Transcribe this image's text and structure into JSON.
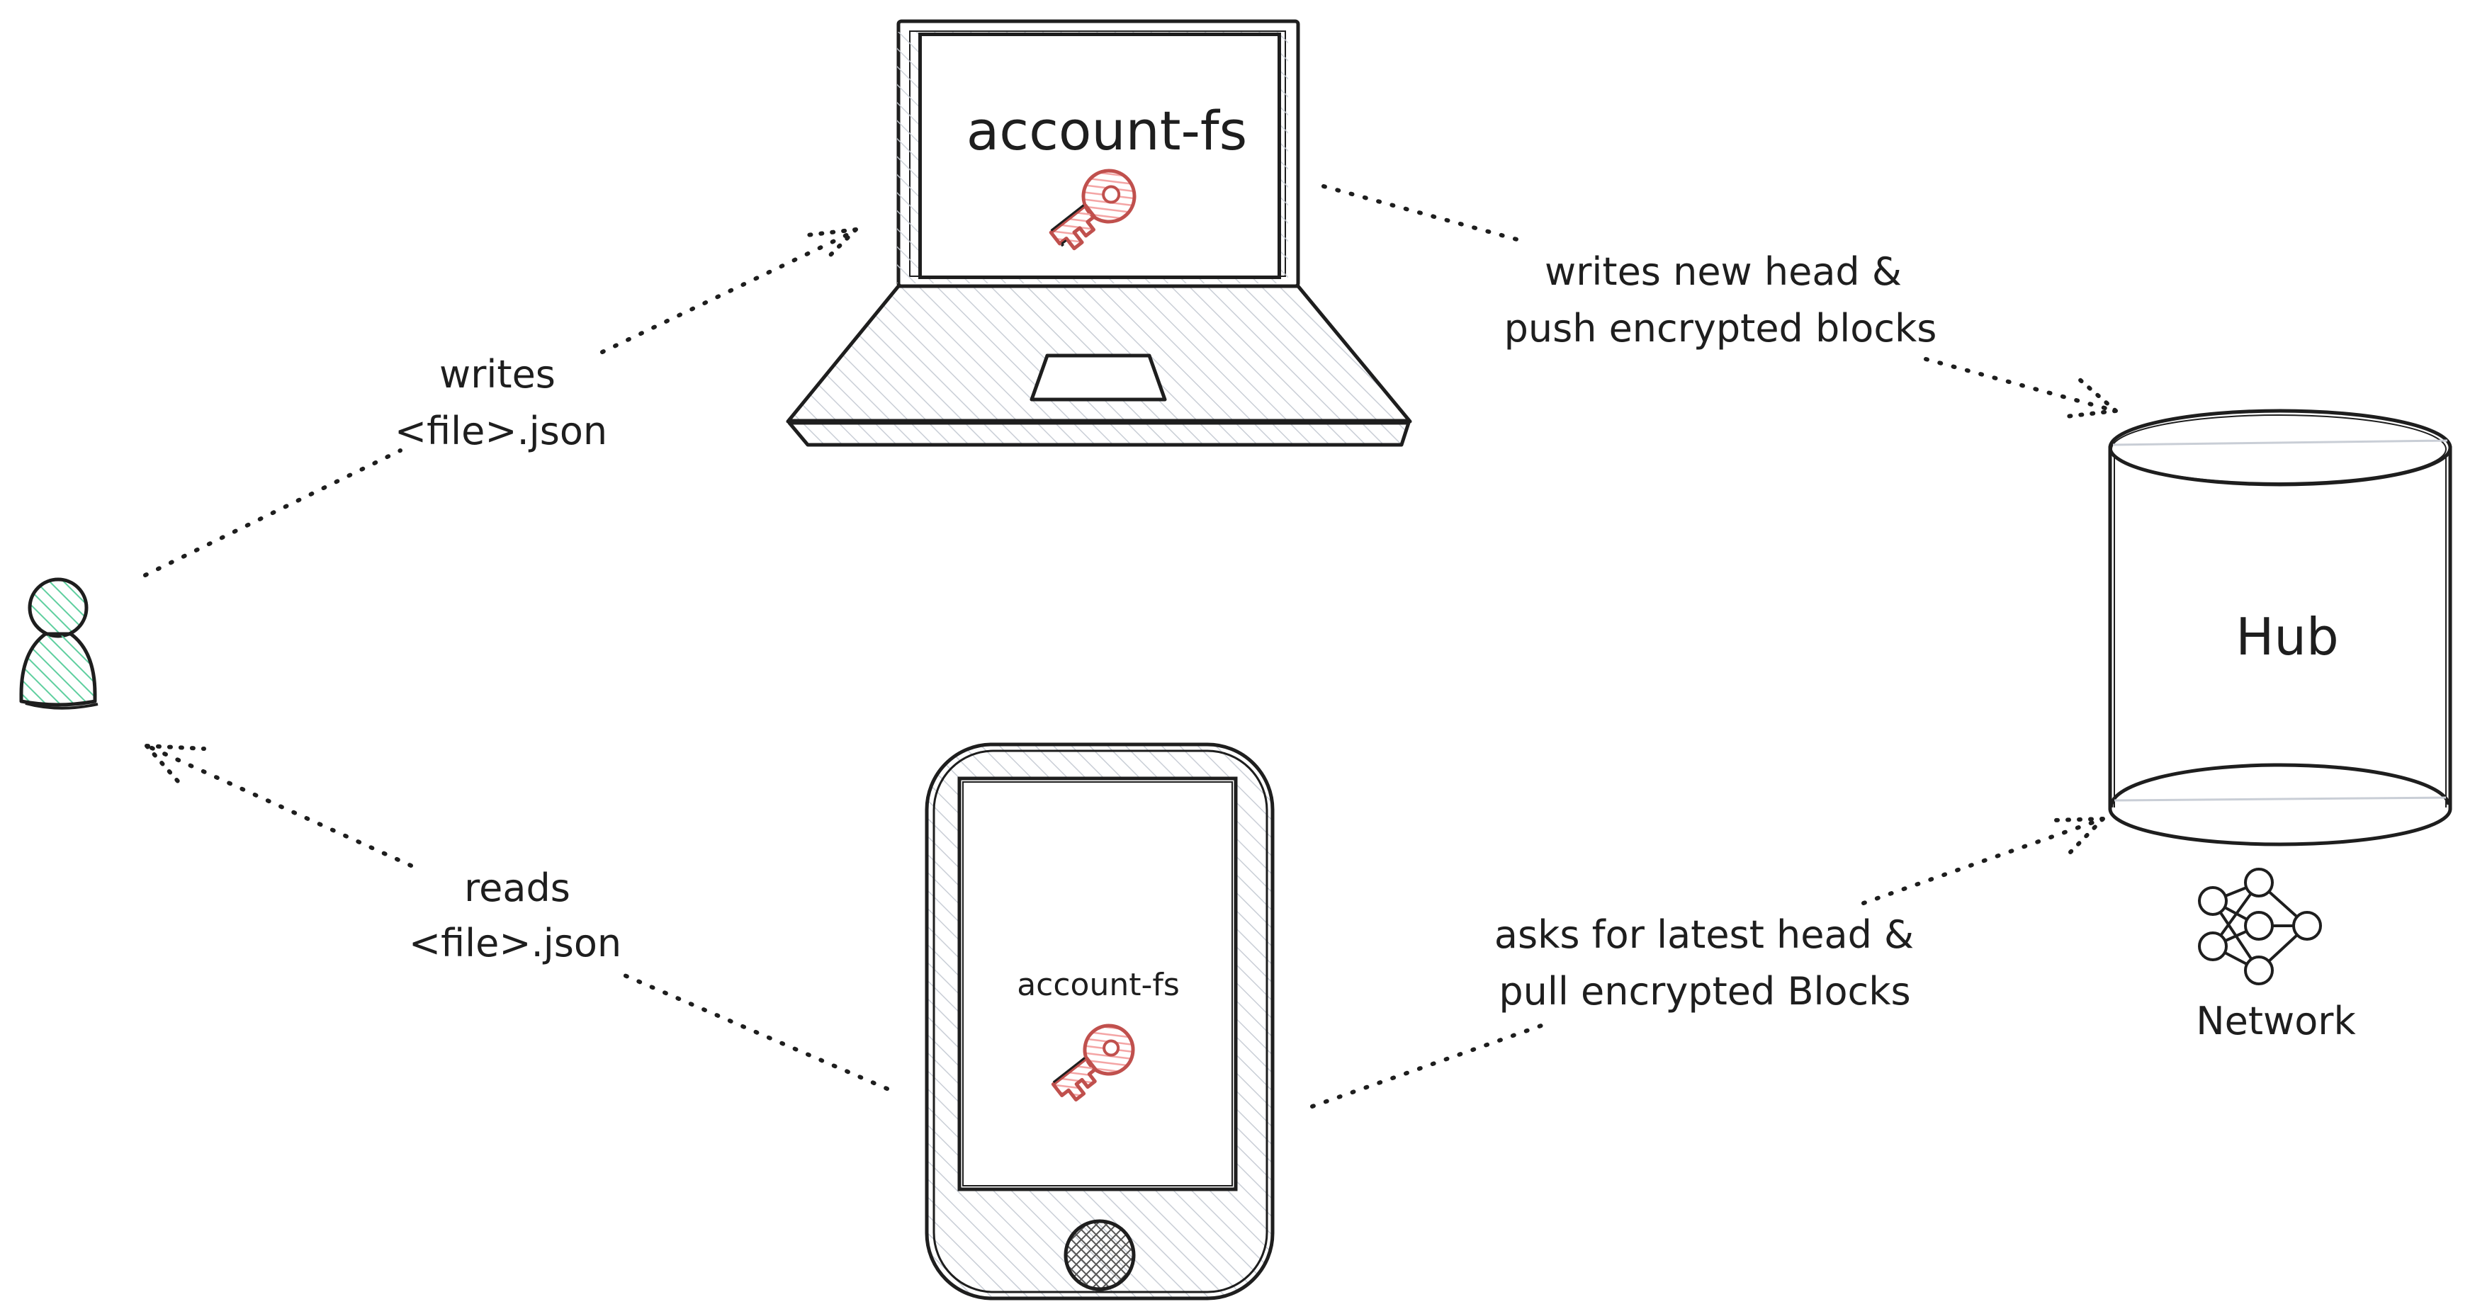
{
  "nodes": {
    "laptop": {
      "label": "account-fs"
    },
    "phone": {
      "label": "account-fs"
    },
    "hub": {
      "label": "Hub"
    },
    "network": {
      "label": "Network"
    }
  },
  "edges": {
    "writes": {
      "line1": "writes",
      "line2": "<file>.json"
    },
    "reads": {
      "line1": "reads",
      "line2": "<file>.json"
    },
    "push": {
      "line1": "writes new head &",
      "line2": "push encrypted blocks"
    },
    "pull": {
      "line1": "asks for latest head &",
      "line2": "pull encrypted Blocks"
    }
  },
  "colors": {
    "ink": "#1e1e1e",
    "hatch": "#c9ced6",
    "user_fill": "#5fcf9f",
    "key_fill": "#f4a5a5",
    "key_stroke": "#c0504d"
  }
}
